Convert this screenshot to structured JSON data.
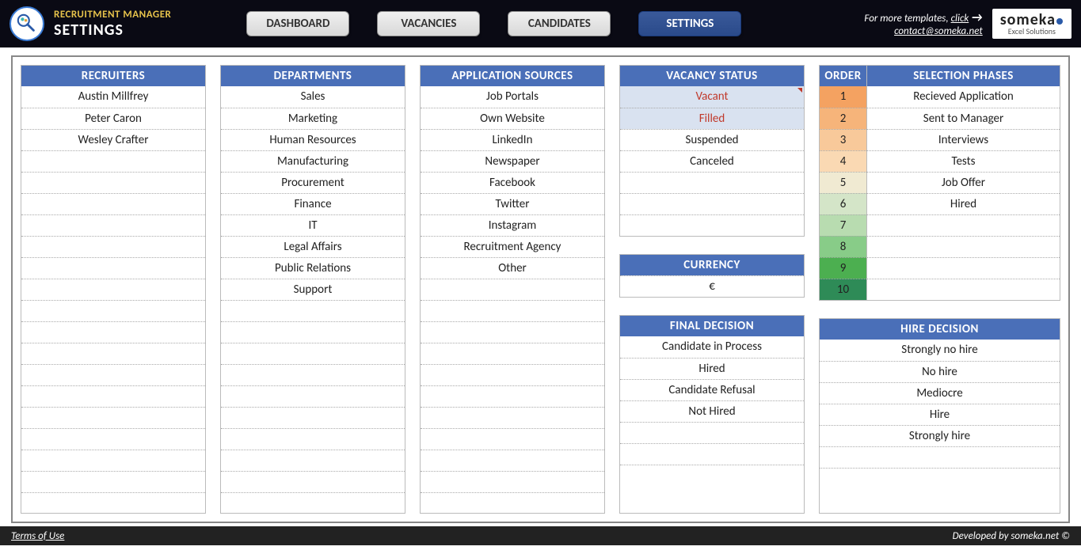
{
  "header": {
    "app_title": "RECRUITMENT MANAGER",
    "page_title": "SETTINGS",
    "nav": [
      "DASHBOARD",
      "VACANCIES",
      "CANDIDATES",
      "SETTINGS"
    ],
    "active_nav": "SETTINGS",
    "more_templates": "For more templates,",
    "click_label": "click",
    "contact": "contact@someka.net",
    "brand_big": "someka",
    "brand_small": "Excel Solutions"
  },
  "panels": {
    "recruiters_hdr": "RECRUITERS",
    "recruiters": [
      "Austin Millfrey",
      "Peter Caron",
      "Wesley Crafter"
    ],
    "departments_hdr": "DEPARTMENTS",
    "departments": [
      "Sales",
      "Marketing",
      "Human Resources",
      "Manufacturing",
      "Procurement",
      "Finance",
      "IT",
      "Legal Affairs",
      "Public Relations",
      "Support"
    ],
    "sources_hdr": "APPLICATION SOURCES",
    "sources": [
      "Job Portals",
      "Own Website",
      "LinkedIn",
      "Newspaper",
      "Facebook",
      "Twitter",
      "Instagram",
      "Recruitment Agency",
      "Other"
    ],
    "vacancy_hdr": "VACANCY STATUS",
    "vacancy": [
      "Vacant",
      "Filled",
      "Suspended",
      "Canceled"
    ],
    "currency_hdr": "CURRENCY",
    "currency": "€",
    "final_hdr": "FINAL DECISION",
    "final": [
      "Candidate in Process",
      "Hired",
      "Candidate Refusal",
      "Not Hired"
    ],
    "order_hdr": "ORDER",
    "phases_hdr": "SELECTION PHASES",
    "orders": [
      1,
      2,
      3,
      4,
      5,
      6,
      7,
      8,
      9,
      10
    ],
    "order_colors": [
      "#f4a261",
      "#f6b47a",
      "#f8c99a",
      "#fad9b3",
      "#f0ead2",
      "#d4e5c8",
      "#b8dcb0",
      "#88cc88",
      "#4caf50",
      "#2e8b57"
    ],
    "phases": [
      "Recieved Application",
      "Sent to Manager",
      "Interviews",
      "Tests",
      "Job Offer",
      "Hired"
    ],
    "hire_hdr": "HIRE DECISION",
    "hire": [
      "Strongly no hire",
      "No hire",
      "Mediocre",
      "Hire",
      "Strongly hire"
    ]
  },
  "footer": {
    "terms": "Terms of Use",
    "developed": "Developed by someka.net ©"
  }
}
